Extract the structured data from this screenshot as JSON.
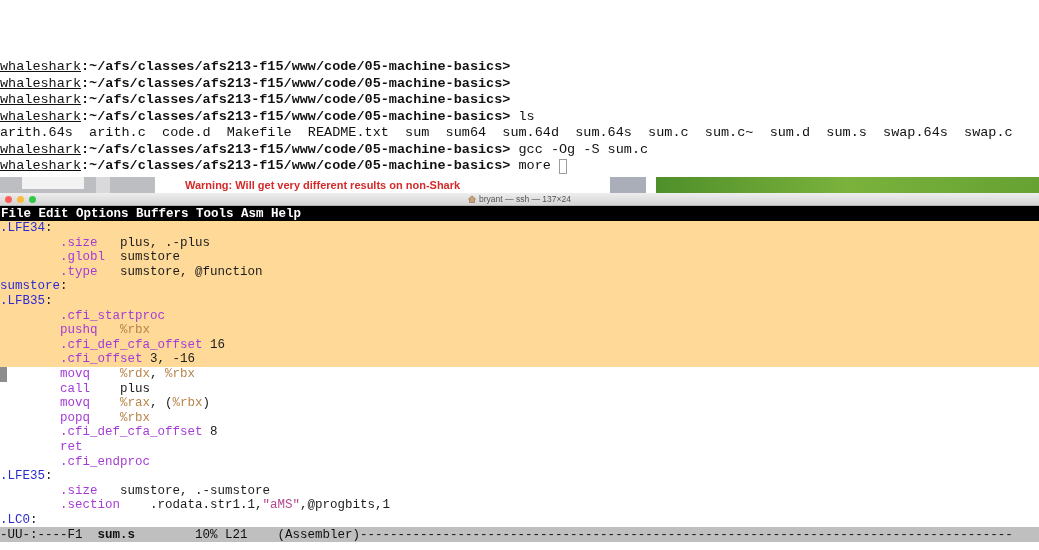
{
  "terminal": {
    "lines": [
      {
        "kind": "prompt",
        "host": "whaleshark",
        "path": ":~/afs/classes/afs213-f15/www/code/05-machine-basics>",
        "cursor": false
      },
      {
        "kind": "prompt",
        "host": "whaleshark",
        "path": ":~/afs/classes/afs213-f15/www/code/05-machine-basics>",
        "cursor": false
      },
      {
        "kind": "prompt",
        "host": "whaleshark",
        "path": ":~/afs/classes/afs213-f15/www/code/05-machine-basics>",
        "cursor": false
      },
      {
        "kind": "prompt",
        "host": "whaleshark",
        "path": ":~/afs/classes/afs213-f15/www/code/05-machine-basics>",
        "command": "ls",
        "cursor": false
      },
      {
        "kind": "output",
        "text": "arith.64s  arith.c  code.d  Makefile  README.txt  sum  sum64  sum.64d  sum.64s  sum.c  sum.c~  sum.d  sum.s  swap.64s  swap.c",
        "cursor": false
      },
      {
        "kind": "prompt",
        "host": "whaleshark",
        "path": ":~/afs/classes/afs213-f15/www/code/05-machine-basics>",
        "command": "gcc -Og -S sum.c",
        "cursor": false
      },
      {
        "kind": "prompt",
        "host": "whaleshark",
        "path": ":~/afs/classes/afs213-f15/www/code/05-machine-basics>",
        "command": "more",
        "cursor": true
      }
    ]
  },
  "background_window": {
    "warning_text": "Warning: Will get very different results on non-Shark"
  },
  "ssh_window": {
    "title": "bryant — ssh — 137×24",
    "menu": [
      "File",
      "Edit",
      "Options",
      "Buffers",
      "Tools",
      "Asm",
      "Help"
    ],
    "editor": {
      "lines": [
        {
          "kind": "label",
          "selected": true,
          "cursor": false,
          "tokens": [
            {
              "kind": "label",
              "text": ".LFE34"
            },
            {
              "kind": "plain",
              "text": ":"
            }
          ]
        },
        {
          "kind": "instruction",
          "selected": true,
          "cursor": false,
          "tokens": [
            {
              "kind": "keyword",
              "text": ".size"
            },
            {
              "kind": "plain",
              "text": "\tplus, .-plus"
            }
          ]
        },
        {
          "kind": "instruction",
          "selected": true,
          "cursor": false,
          "tokens": [
            {
              "kind": "keyword",
              "text": ".globl"
            },
            {
              "kind": "plain",
              "text": "\tsumstore"
            }
          ]
        },
        {
          "kind": "instruction",
          "selected": true,
          "cursor": false,
          "tokens": [
            {
              "kind": "keyword",
              "text": ".type"
            },
            {
              "kind": "plain",
              "text": "\tsumstore, @function"
            }
          ]
        },
        {
          "kind": "label",
          "selected": true,
          "cursor": false,
          "tokens": [
            {
              "kind": "label",
              "text": "sumstore"
            },
            {
              "kind": "plain",
              "text": ":"
            }
          ]
        },
        {
          "kind": "label",
          "selected": true,
          "cursor": false,
          "tokens": [
            {
              "kind": "label",
              "text": ".LFB35"
            },
            {
              "kind": "plain",
              "text": ":"
            }
          ]
        },
        {
          "kind": "instruction",
          "selected": true,
          "cursor": false,
          "tokens": [
            {
              "kind": "keyword",
              "text": ".cfi_startproc"
            }
          ]
        },
        {
          "kind": "instruction",
          "selected": true,
          "cursor": false,
          "tokens": [
            {
              "kind": "keyword",
              "text": "pushq"
            },
            {
              "kind": "register",
              "text": "\t%rbx"
            }
          ]
        },
        {
          "kind": "instruction",
          "selected": true,
          "cursor": false,
          "tokens": [
            {
              "kind": "keyword",
              "text": ".cfi_def_cfa_offset"
            },
            {
              "kind": "plain",
              "text": " 16"
            }
          ]
        },
        {
          "kind": "instruction",
          "selected": true,
          "cursor": false,
          "tokens": [
            {
              "kind": "keyword",
              "text": ".cfi_offset"
            },
            {
              "kind": "plain",
              "text": " 3, -16"
            }
          ]
        },
        {
          "kind": "instruction",
          "selected": false,
          "cursor": true,
          "tokens": [
            {
              "kind": "keyword",
              "text": "movq"
            },
            {
              "kind": "register",
              "text": "\t%rdx"
            },
            {
              "kind": "plain",
              "text": ", "
            },
            {
              "kind": "register",
              "text": "%rbx"
            }
          ]
        },
        {
          "kind": "instruction",
          "selected": false,
          "cursor": false,
          "tokens": [
            {
              "kind": "keyword",
              "text": "call"
            },
            {
              "kind": "plain",
              "text": "\tplus"
            }
          ]
        },
        {
          "kind": "instruction",
          "selected": false,
          "cursor": false,
          "tokens": [
            {
              "kind": "keyword",
              "text": "movq"
            },
            {
              "kind": "register",
              "text": "\t%rax"
            },
            {
              "kind": "plain",
              "text": ", ("
            },
            {
              "kind": "register",
              "text": "%rbx"
            },
            {
              "kind": "plain",
              "text": ")"
            }
          ]
        },
        {
          "kind": "instruction",
          "selected": false,
          "cursor": false,
          "tokens": [
            {
              "kind": "keyword",
              "text": "popq"
            },
            {
              "kind": "register",
              "text": "\t%rbx"
            }
          ]
        },
        {
          "kind": "instruction",
          "selected": false,
          "cursor": false,
          "tokens": [
            {
              "kind": "keyword",
              "text": ".cfi_def_cfa_offset"
            },
            {
              "kind": "plain",
              "text": " 8"
            }
          ]
        },
        {
          "kind": "instruction",
          "selected": false,
          "cursor": false,
          "tokens": [
            {
              "kind": "keyword",
              "text": "ret"
            }
          ]
        },
        {
          "kind": "instruction",
          "selected": false,
          "cursor": false,
          "tokens": [
            {
              "kind": "keyword",
              "text": ".cfi_endproc"
            }
          ]
        },
        {
          "kind": "label",
          "selected": false,
          "cursor": false,
          "tokens": [
            {
              "kind": "label",
              "text": ".LFE35"
            },
            {
              "kind": "plain",
              "text": ":"
            }
          ]
        },
        {
          "kind": "instruction",
          "selected": false,
          "cursor": false,
          "tokens": [
            {
              "kind": "keyword",
              "text": ".size"
            },
            {
              "kind": "plain",
              "text": "\tsumstore, .-sumstore"
            }
          ]
        },
        {
          "kind": "instruction",
          "selected": false,
          "cursor": false,
          "tokens": [
            {
              "kind": "keyword",
              "text": ".section"
            },
            {
              "kind": "plain",
              "text": "\t.rodata.str1.1,"
            },
            {
              "kind": "string",
              "text": "\"aMS\""
            },
            {
              "kind": "plain",
              "text": ",@progbits,1"
            }
          ]
        },
        {
          "kind": "label",
          "selected": false,
          "cursor": false,
          "tokens": [
            {
              "kind": "label",
              "text": ".LC0"
            },
            {
              "kind": "plain",
              "text": ":"
            }
          ]
        }
      ]
    },
    "mode_line": "-UU-:----F1  **sum.s**        10% L21    (Assembler)---------------------------------------------------------------------------------------"
  }
}
